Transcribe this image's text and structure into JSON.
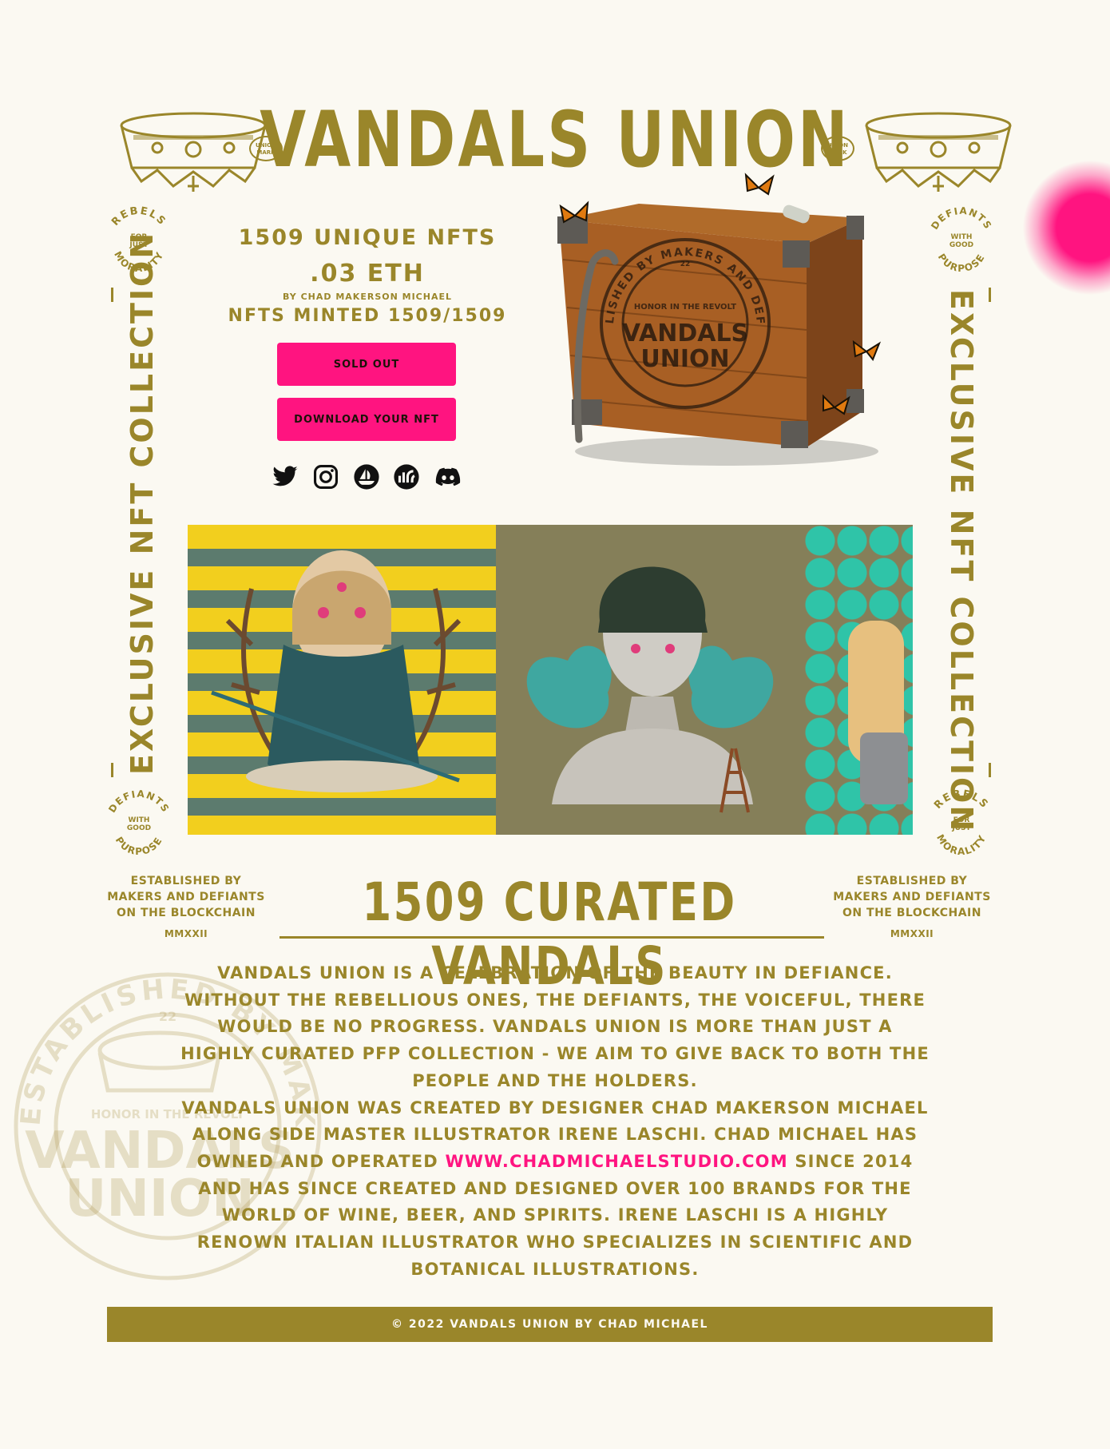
{
  "header": {
    "title": "VANDALS UNION",
    "union_mark_left": "UNION MARK",
    "union_mark_right": "UNION MARK"
  },
  "side_text": {
    "left": "EXCLUSIVE NFT COLLECTION",
    "right": "EXCLUSIVE NFT COLLECTION"
  },
  "badges": {
    "top_left": {
      "arc_top": "REBELS",
      "middle": "FOR JUST",
      "arc_bottom": "MORALITY"
    },
    "top_right": {
      "arc_top": "DEFIANTS",
      "middle": "WITH GOOD",
      "arc_bottom": "PURPOSE"
    },
    "bottom_left": {
      "arc_top": "DEFIANTS",
      "middle": "WITH GOOD",
      "arc_bottom": "PURPOSE"
    },
    "bottom_right": {
      "arc_top": "REBELS",
      "middle": "FOR JUST",
      "arc_bottom": "MORALITY"
    }
  },
  "mint": {
    "unique": "1509 UNIQUE NFTS",
    "price": ".03 ETH",
    "by": "BY CHAD MAKERSON MICHAEL",
    "minted": "NFTS MINTED 1509/1509",
    "sold_out_label": "SOLD OUT",
    "download_label": "DOWNLOAD YOUR NFT"
  },
  "crate": {
    "ring_text": "ESTABLISHED BY MAKERS AND DEFIANTS",
    "small": "HONOR IN THE REVOLT",
    "num": "22",
    "line1": "VANDALS",
    "line2": "UNION"
  },
  "social": [
    "twitter-icon",
    "instagram-icon",
    "opensea-icon",
    "looksrare-icon",
    "discord-icon"
  ],
  "established": {
    "line1": "ESTABLISHED BY",
    "line2": "MAKERS AND DEFIANTS",
    "line3": "ON THE BLOCKCHAIN",
    "year": "MMXXII"
  },
  "curated_title": "1509 CURATED VANDALS",
  "about": {
    "p1": "Vandals Union is a celebration of the beauty in defiance. Without the rebellious ones, the defiants, the voiceful, there would be no progress. Vandals Union is more than just a highly curated PFP collection - we aim to give back to both the people and the holders.",
    "p2_before": "Vandals Union was created by designer Chad Makerson Michael along side master illustrator Irene Laschi. Chad Michael has owned and operated",
    "link": "www.chadmichaelstudio.com",
    "p2_after": "since 2014 and has since created and designed over 100 brands for the world of wine, beer, and spirits. Irene Laschi is a highly renown Italian illustrator who specializes in scientific and botanical illustrations."
  },
  "watermark": {
    "ring_text": "ESTABLISHED BY MAKERS AND DEFIANTS",
    "num": "22",
    "small": "HONOR IN THE REVOLT",
    "line1": "VANDALS",
    "line2": "UNION"
  },
  "footer": "© 2022 VANDALS UNION BY CHAD MICHAEL",
  "colors": {
    "gold": "#9a862a",
    "pink": "#ff1480",
    "bg": "#fbf9f2"
  }
}
